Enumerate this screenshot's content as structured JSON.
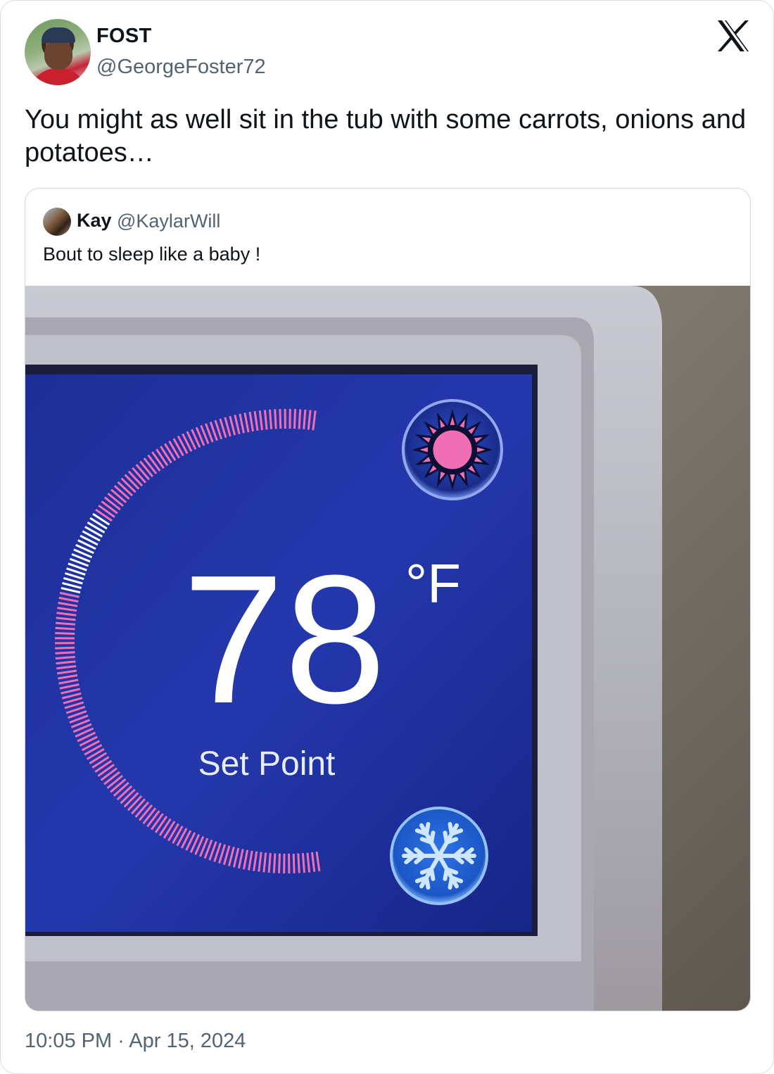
{
  "author": {
    "display_name": "FOST",
    "handle": "@GeorgeFoster72"
  },
  "tweet": {
    "text": "You might as well sit in the tub with some carrots, onions and potatoes…",
    "timestamp": "10:05 PM · Apr 15, 2024"
  },
  "quoted_tweet": {
    "display_name": "Kay",
    "handle": "@KaylarWill",
    "text": "Bout to sleep like a baby !",
    "thermostat": {
      "temperature": "78",
      "unit": "°F",
      "label": "Set Point",
      "modes": [
        "sun-icon",
        "snowflake-icon"
      ]
    }
  },
  "icons": {
    "brand": "x-logo-icon"
  },
  "colors": {
    "text_primary": "#0f1419",
    "text_secondary": "#536471",
    "screen_blue": "#1b2f9c",
    "heat_pink": "#f06fb4"
  }
}
